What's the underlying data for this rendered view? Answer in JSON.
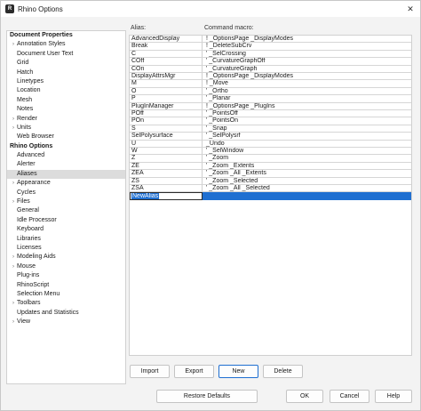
{
  "window": {
    "title": "Rhino Options",
    "close_glyph": "✕",
    "app_icon": "rhino-app-icon"
  },
  "tree": [
    {
      "label": "Document Properties",
      "kind": "section"
    },
    {
      "label": "Annotation Styles",
      "kind": "item",
      "expandable": true
    },
    {
      "label": "Document User Text",
      "kind": "item"
    },
    {
      "label": "Grid",
      "kind": "item"
    },
    {
      "label": "Hatch",
      "kind": "item"
    },
    {
      "label": "Linetypes",
      "kind": "item"
    },
    {
      "label": "Location",
      "kind": "item"
    },
    {
      "label": "Mesh",
      "kind": "item"
    },
    {
      "label": "Notes",
      "kind": "item"
    },
    {
      "label": "Render",
      "kind": "item",
      "expandable": true
    },
    {
      "label": "Units",
      "kind": "item",
      "expandable": true
    },
    {
      "label": "Web Browser",
      "kind": "item"
    },
    {
      "label": "Rhino Options",
      "kind": "section"
    },
    {
      "label": "Advanced",
      "kind": "item"
    },
    {
      "label": "Alerter",
      "kind": "item"
    },
    {
      "label": "Aliases",
      "kind": "item",
      "selected": true
    },
    {
      "label": "Appearance",
      "kind": "item",
      "expandable": true
    },
    {
      "label": "Cycles",
      "kind": "item"
    },
    {
      "label": "Files",
      "kind": "item",
      "expandable": true
    },
    {
      "label": "General",
      "kind": "item"
    },
    {
      "label": "Idle Processor",
      "kind": "item"
    },
    {
      "label": "Keyboard",
      "kind": "item"
    },
    {
      "label": "Libraries",
      "kind": "item"
    },
    {
      "label": "Licenses",
      "kind": "item"
    },
    {
      "label": "Modeling Aids",
      "kind": "item",
      "expandable": true
    },
    {
      "label": "Mouse",
      "kind": "item",
      "expandable": true
    },
    {
      "label": "Plug-ins",
      "kind": "item"
    },
    {
      "label": "RhinoScript",
      "kind": "item"
    },
    {
      "label": "Selection Menu",
      "kind": "item"
    },
    {
      "label": "Toolbars",
      "kind": "item",
      "expandable": true
    },
    {
      "label": "Updates and Statistics",
      "kind": "item"
    },
    {
      "label": "View",
      "kind": "item",
      "expandable": true
    }
  ],
  "aliases": {
    "alias_header": "Alias:",
    "macro_header": "Command macro:",
    "rows": [
      {
        "alias": "AdvancedDisplay",
        "macro": "! _OptionsPage _DisplayModes"
      },
      {
        "alias": "Break",
        "macro": "! _DeleteSubCrv"
      },
      {
        "alias": "C",
        "macro": "' _SelCrossing"
      },
      {
        "alias": "COff",
        "macro": "' _CurvatureGraphOff"
      },
      {
        "alias": "COn",
        "macro": "' _CurvatureGraph"
      },
      {
        "alias": "DisplayAttrsMgr",
        "macro": "! _OptionsPage _DisplayModes"
      },
      {
        "alias": "M",
        "macro": "! _Move"
      },
      {
        "alias": "O",
        "macro": "' _Ortho"
      },
      {
        "alias": "P",
        "macro": "' _Planar"
      },
      {
        "alias": "PlugInManager",
        "macro": "! _OptionsPage _PlugIns"
      },
      {
        "alias": "POff",
        "macro": "' _PointsOff"
      },
      {
        "alias": "POn",
        "macro": "' _PointsOn"
      },
      {
        "alias": "S",
        "macro": "' _Snap"
      },
      {
        "alias": "SelPolysurface",
        "macro": "' _SelPolysrf"
      },
      {
        "alias": "U",
        "macro": "_Undo"
      },
      {
        "alias": "W",
        "macro": "' _SelWindow"
      },
      {
        "alias": "Z",
        "macro": "' _Zoom"
      },
      {
        "alias": "ZE",
        "macro": "' _Zoom _Extents"
      },
      {
        "alias": "ZEA",
        "macro": "' _Zoom _All _Extents"
      },
      {
        "alias": "ZS",
        "macro": "' _Zoom _Selected"
      },
      {
        "alias": "ZSA",
        "macro": "' _Zoom _All _Selected"
      }
    ],
    "new_row": {
      "alias": "NewAlias",
      "macro": ""
    }
  },
  "buttons": {
    "import": "Import",
    "export": "Export",
    "new": "New",
    "delete": "Delete",
    "restore_defaults": "Restore Defaults",
    "ok": "OK",
    "cancel": "Cancel",
    "help": "Help"
  },
  "colors": {
    "selection_blue": "#1f6fd1",
    "tree_selected": "#dcdcdc",
    "background": "#f3f3f3"
  }
}
